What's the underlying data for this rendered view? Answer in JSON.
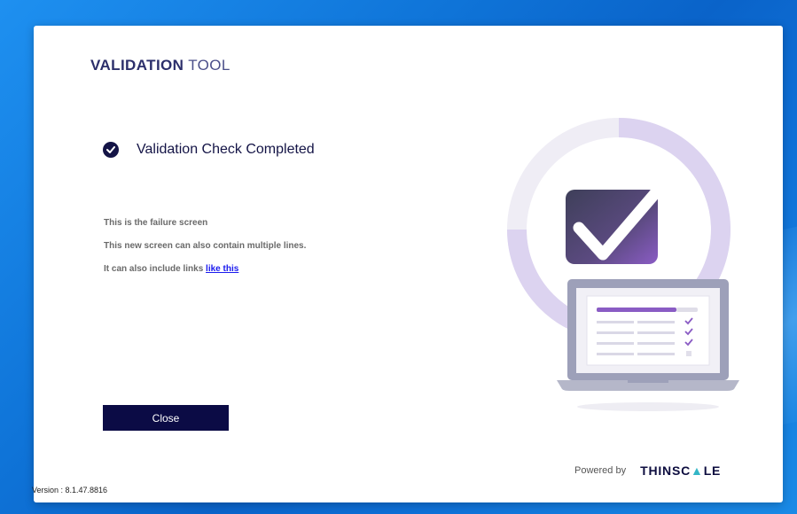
{
  "app": {
    "title_bold": "VALIDATION",
    "title_light": "TOOL"
  },
  "status": {
    "title": "Validation Check Completed",
    "icon": "check-circle-icon"
  },
  "messages": {
    "line1": "This is the failure screen",
    "line2": "This new screen can also contain multiple lines.",
    "line3_prefix": "It can also include links",
    "line3_link": "like this"
  },
  "actions": {
    "close_label": "Close"
  },
  "footer": {
    "powered_by": "Powered by",
    "brand_prefix": "THINSC",
    "brand_triangle": "▲",
    "brand_suffix": "LE",
    "version": "Version : 8.1.47.8816"
  },
  "colors": {
    "navy": "#0b0b45",
    "accent_purple": "#8a5cc4",
    "ring_lavender": "#d8cfee",
    "link": "#1a1aee"
  }
}
